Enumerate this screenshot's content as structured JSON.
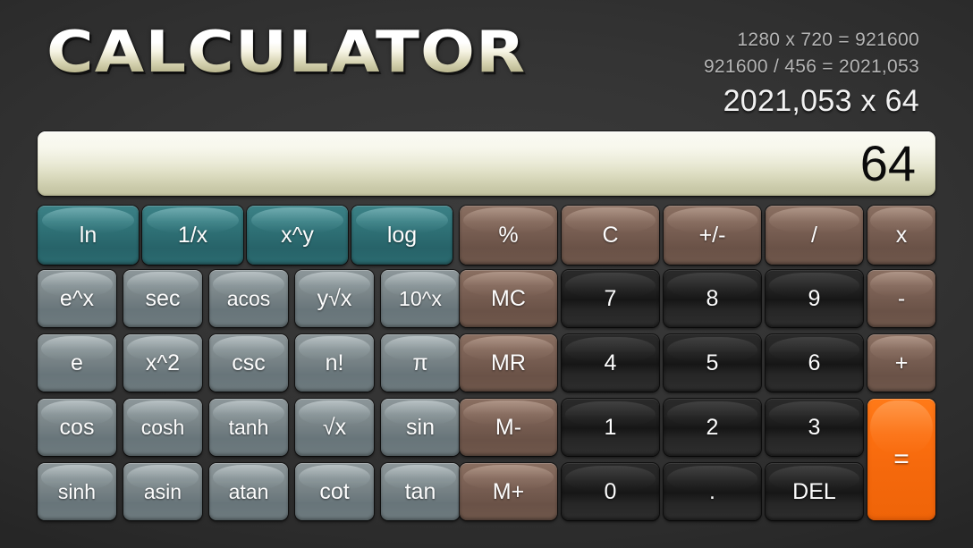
{
  "app": {
    "title": "CALCULATOR",
    "background_color": "#343434",
    "accent_color": "#ff7a18"
  },
  "history": {
    "lines": [
      "1280 x 720 = 921600",
      "921600 / 456 = 2021,053"
    ],
    "current_expression": "2021,053 x 64"
  },
  "display": {
    "value": "64",
    "text_color": "#0b0b0b",
    "background_color": "#ebebd8"
  },
  "keypad": {
    "rows": [
      {
        "name": "row-1",
        "keys": [
          {
            "label": "ln",
            "name": "key-ln",
            "style": "teal"
          },
          {
            "label": "1/x",
            "name": "key-reciprocal",
            "style": "teal"
          },
          {
            "label": "x^y",
            "name": "key-power",
            "style": "teal"
          },
          {
            "label": "log",
            "name": "key-log",
            "style": "teal"
          },
          {
            "label": "%",
            "name": "key-percent",
            "style": "brown"
          },
          {
            "label": "C",
            "name": "key-clear",
            "style": "brown"
          },
          {
            "label": "+/-",
            "name": "key-sign",
            "style": "brown"
          },
          {
            "label": "/",
            "name": "key-divide",
            "style": "brown"
          },
          {
            "label": "x",
            "name": "key-multiply",
            "style": "brown"
          }
        ]
      },
      {
        "name": "row-2",
        "keys": [
          {
            "label": "e^x",
            "name": "key-exp",
            "style": "gray"
          },
          {
            "label": "sec",
            "name": "key-sec",
            "style": "gray"
          },
          {
            "label": "acos",
            "name": "key-acos",
            "style": "gray"
          },
          {
            "label": "y√x",
            "name": "key-nth-root",
            "style": "gray"
          },
          {
            "label": "10^x",
            "name": "key-ten-power",
            "style": "gray"
          },
          {
            "label": "MC",
            "name": "key-memory-clear",
            "style": "brown"
          },
          {
            "label": "7",
            "name": "key-7",
            "style": "dark"
          },
          {
            "label": "8",
            "name": "key-8",
            "style": "dark"
          },
          {
            "label": "9",
            "name": "key-9",
            "style": "dark"
          },
          {
            "label": "-",
            "name": "key-subtract",
            "style": "brown"
          }
        ]
      },
      {
        "name": "row-3",
        "keys": [
          {
            "label": "e",
            "name": "key-euler",
            "style": "gray"
          },
          {
            "label": "x^2",
            "name": "key-square",
            "style": "gray"
          },
          {
            "label": "csc",
            "name": "key-csc",
            "style": "gray"
          },
          {
            "label": "n!",
            "name": "key-factorial",
            "style": "gray"
          },
          {
            "label": "π",
            "name": "key-pi",
            "style": "gray"
          },
          {
            "label": "MR",
            "name": "key-memory-recall",
            "style": "brown"
          },
          {
            "label": "4",
            "name": "key-4",
            "style": "dark"
          },
          {
            "label": "5",
            "name": "key-5",
            "style": "dark"
          },
          {
            "label": "6",
            "name": "key-6",
            "style": "dark"
          },
          {
            "label": "+",
            "name": "key-add",
            "style": "brown"
          }
        ]
      },
      {
        "name": "row-4",
        "keys": [
          {
            "label": "cos",
            "name": "key-cos",
            "style": "gray"
          },
          {
            "label": "cosh",
            "name": "key-cosh",
            "style": "gray"
          },
          {
            "label": "tanh",
            "name": "key-tanh",
            "style": "gray"
          },
          {
            "label": "√x",
            "name": "key-sqrt",
            "style": "gray"
          },
          {
            "label": "sin",
            "name": "key-sin",
            "style": "gray"
          },
          {
            "label": "M-",
            "name": "key-memory-subtract",
            "style": "brown"
          },
          {
            "label": "1",
            "name": "key-1",
            "style": "dark"
          },
          {
            "label": "2",
            "name": "key-2",
            "style": "dark"
          },
          {
            "label": "3",
            "name": "key-3",
            "style": "dark"
          },
          {
            "label": "=",
            "name": "key-equals",
            "style": "orange"
          }
        ]
      },
      {
        "name": "row-5",
        "keys": [
          {
            "label": "sinh",
            "name": "key-sinh",
            "style": "gray"
          },
          {
            "label": "asin",
            "name": "key-asin",
            "style": "gray"
          },
          {
            "label": "atan",
            "name": "key-atan",
            "style": "gray"
          },
          {
            "label": "cot",
            "name": "key-cot",
            "style": "gray"
          },
          {
            "label": "tan",
            "name": "key-tan",
            "style": "gray"
          },
          {
            "label": "M+",
            "name": "key-memory-add",
            "style": "brown"
          },
          {
            "label": "0",
            "name": "key-0",
            "style": "dark"
          },
          {
            "label": ".",
            "name": "key-decimal",
            "style": "dark"
          },
          {
            "label": "DEL",
            "name": "key-delete",
            "style": "dark"
          }
        ]
      }
    ]
  }
}
